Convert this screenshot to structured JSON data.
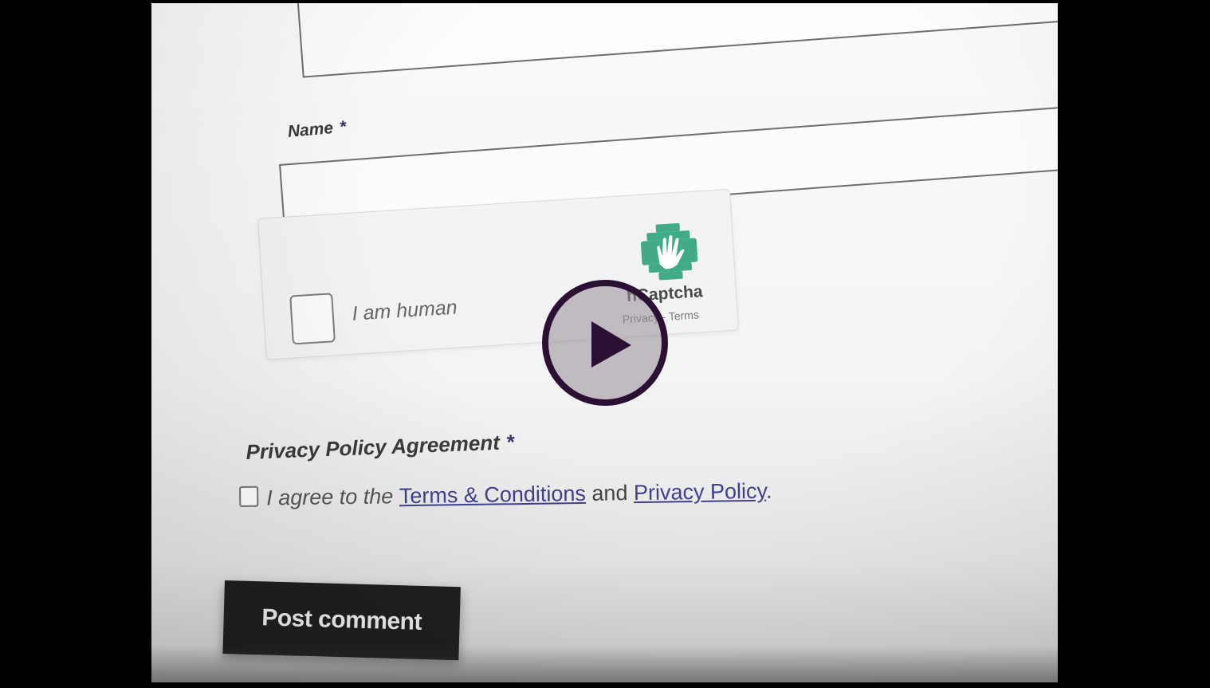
{
  "form": {
    "name_label": "Name",
    "required_marker": "*",
    "captcha": {
      "checkbox_label": "I am human",
      "brand": "hCaptcha",
      "links": "Privacy - Terms"
    },
    "privacy": {
      "heading": "Privacy Policy Agreement",
      "agree_prefix": "I agree to the",
      "terms_link": "Terms & Conditions",
      "conjunction": "and",
      "privacy_link": "Privacy Policy",
      "suffix": "."
    },
    "submit_label": "Post comment"
  },
  "video": {
    "play_icon": "play-icon"
  },
  "colors": {
    "player_background": "#000000",
    "play_ring": "#2b1033",
    "link": "#3f3f8e",
    "button": "#1f1f1f",
    "captcha_logo": "#2ea37e"
  }
}
